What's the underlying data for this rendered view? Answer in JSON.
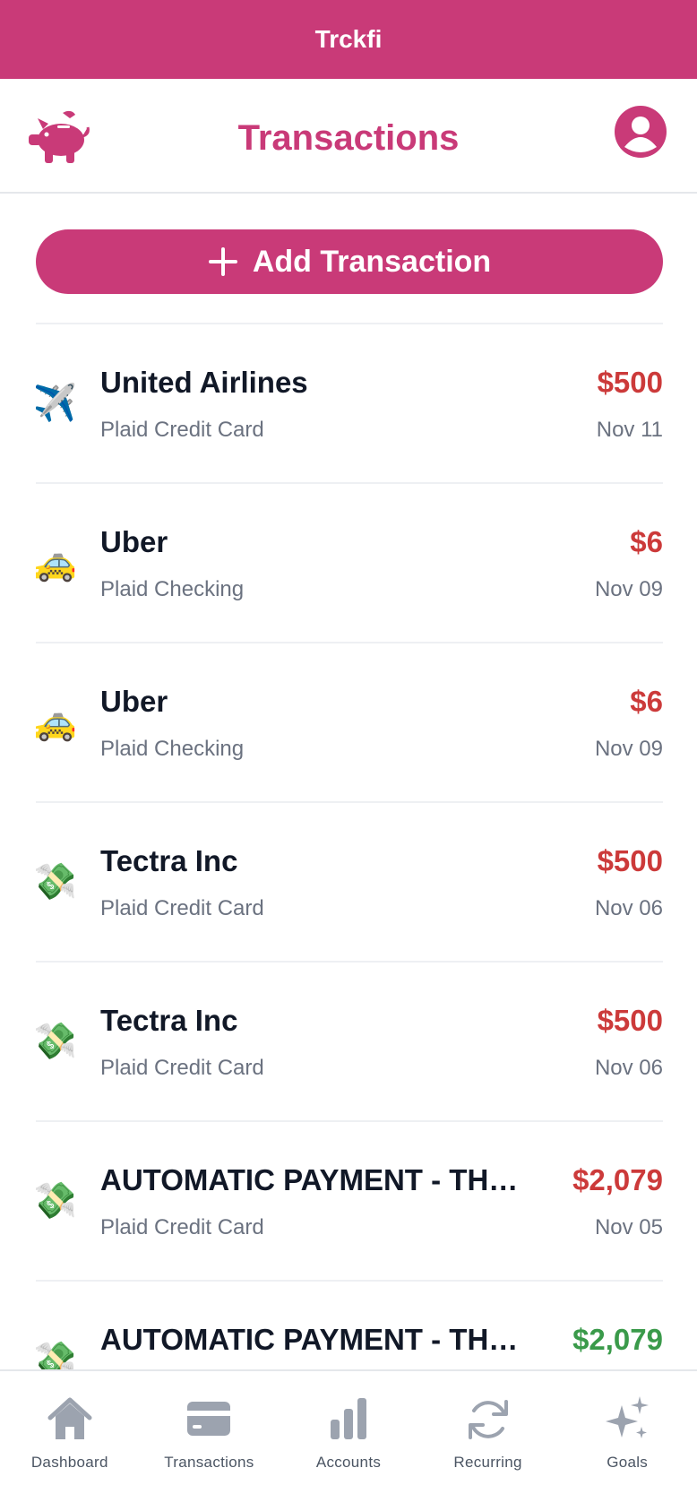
{
  "app": {
    "name": "Trckfi"
  },
  "header": {
    "title": "Transactions",
    "logo_icon": "piggy-bank-icon",
    "profile_icon": "user-circle-icon"
  },
  "actions": {
    "add_label": "Add Transaction",
    "add_icon": "plus-icon"
  },
  "colors": {
    "brand": "#c93a78",
    "debit": "#cc3a3a",
    "credit": "#3a9a4a",
    "muted": "#6b7280",
    "text": "#111827"
  },
  "transactions": [
    {
      "icon": "✈️",
      "icon_name": "airplane-icon",
      "name": "United Airlines",
      "account": "Plaid Credit Card",
      "amount": "$500",
      "date": "Nov 11",
      "type": "debit"
    },
    {
      "icon": "🚕",
      "icon_name": "taxi-icon",
      "name": "Uber",
      "account": "Plaid Checking",
      "amount": "$6",
      "date": "Nov 09",
      "type": "debit"
    },
    {
      "icon": "🚕",
      "icon_name": "taxi-icon",
      "name": "Uber",
      "account": "Plaid Checking",
      "amount": "$6",
      "date": "Nov 09",
      "type": "debit"
    },
    {
      "icon": "💸",
      "icon_name": "money-with-wings-icon",
      "name": "Tectra Inc",
      "account": "Plaid Credit Card",
      "amount": "$500",
      "date": "Nov 06",
      "type": "debit"
    },
    {
      "icon": "💸",
      "icon_name": "money-with-wings-icon",
      "name": "Tectra Inc",
      "account": "Plaid Credit Card",
      "amount": "$500",
      "date": "Nov 06",
      "type": "debit"
    },
    {
      "icon": "💸",
      "icon_name": "money-with-wings-icon",
      "name": "AUTOMATIC PAYMENT - THA...",
      "account": "Plaid Credit Card",
      "amount": "$2,079",
      "date": "Nov 05",
      "type": "debit"
    },
    {
      "icon": "💸",
      "icon_name": "money-with-wings-icon",
      "name": "AUTOMATIC PAYMENT - THA...",
      "account": "",
      "amount": "$2,079",
      "date": "",
      "type": "credit"
    }
  ],
  "tabs": [
    {
      "label": "Dashboard",
      "icon": "home-icon"
    },
    {
      "label": "Transactions",
      "icon": "credit-card-icon"
    },
    {
      "label": "Accounts",
      "icon": "bar-chart-icon"
    },
    {
      "label": "Recurring",
      "icon": "refresh-icon"
    },
    {
      "label": "Goals",
      "icon": "sparkles-icon"
    }
  ]
}
